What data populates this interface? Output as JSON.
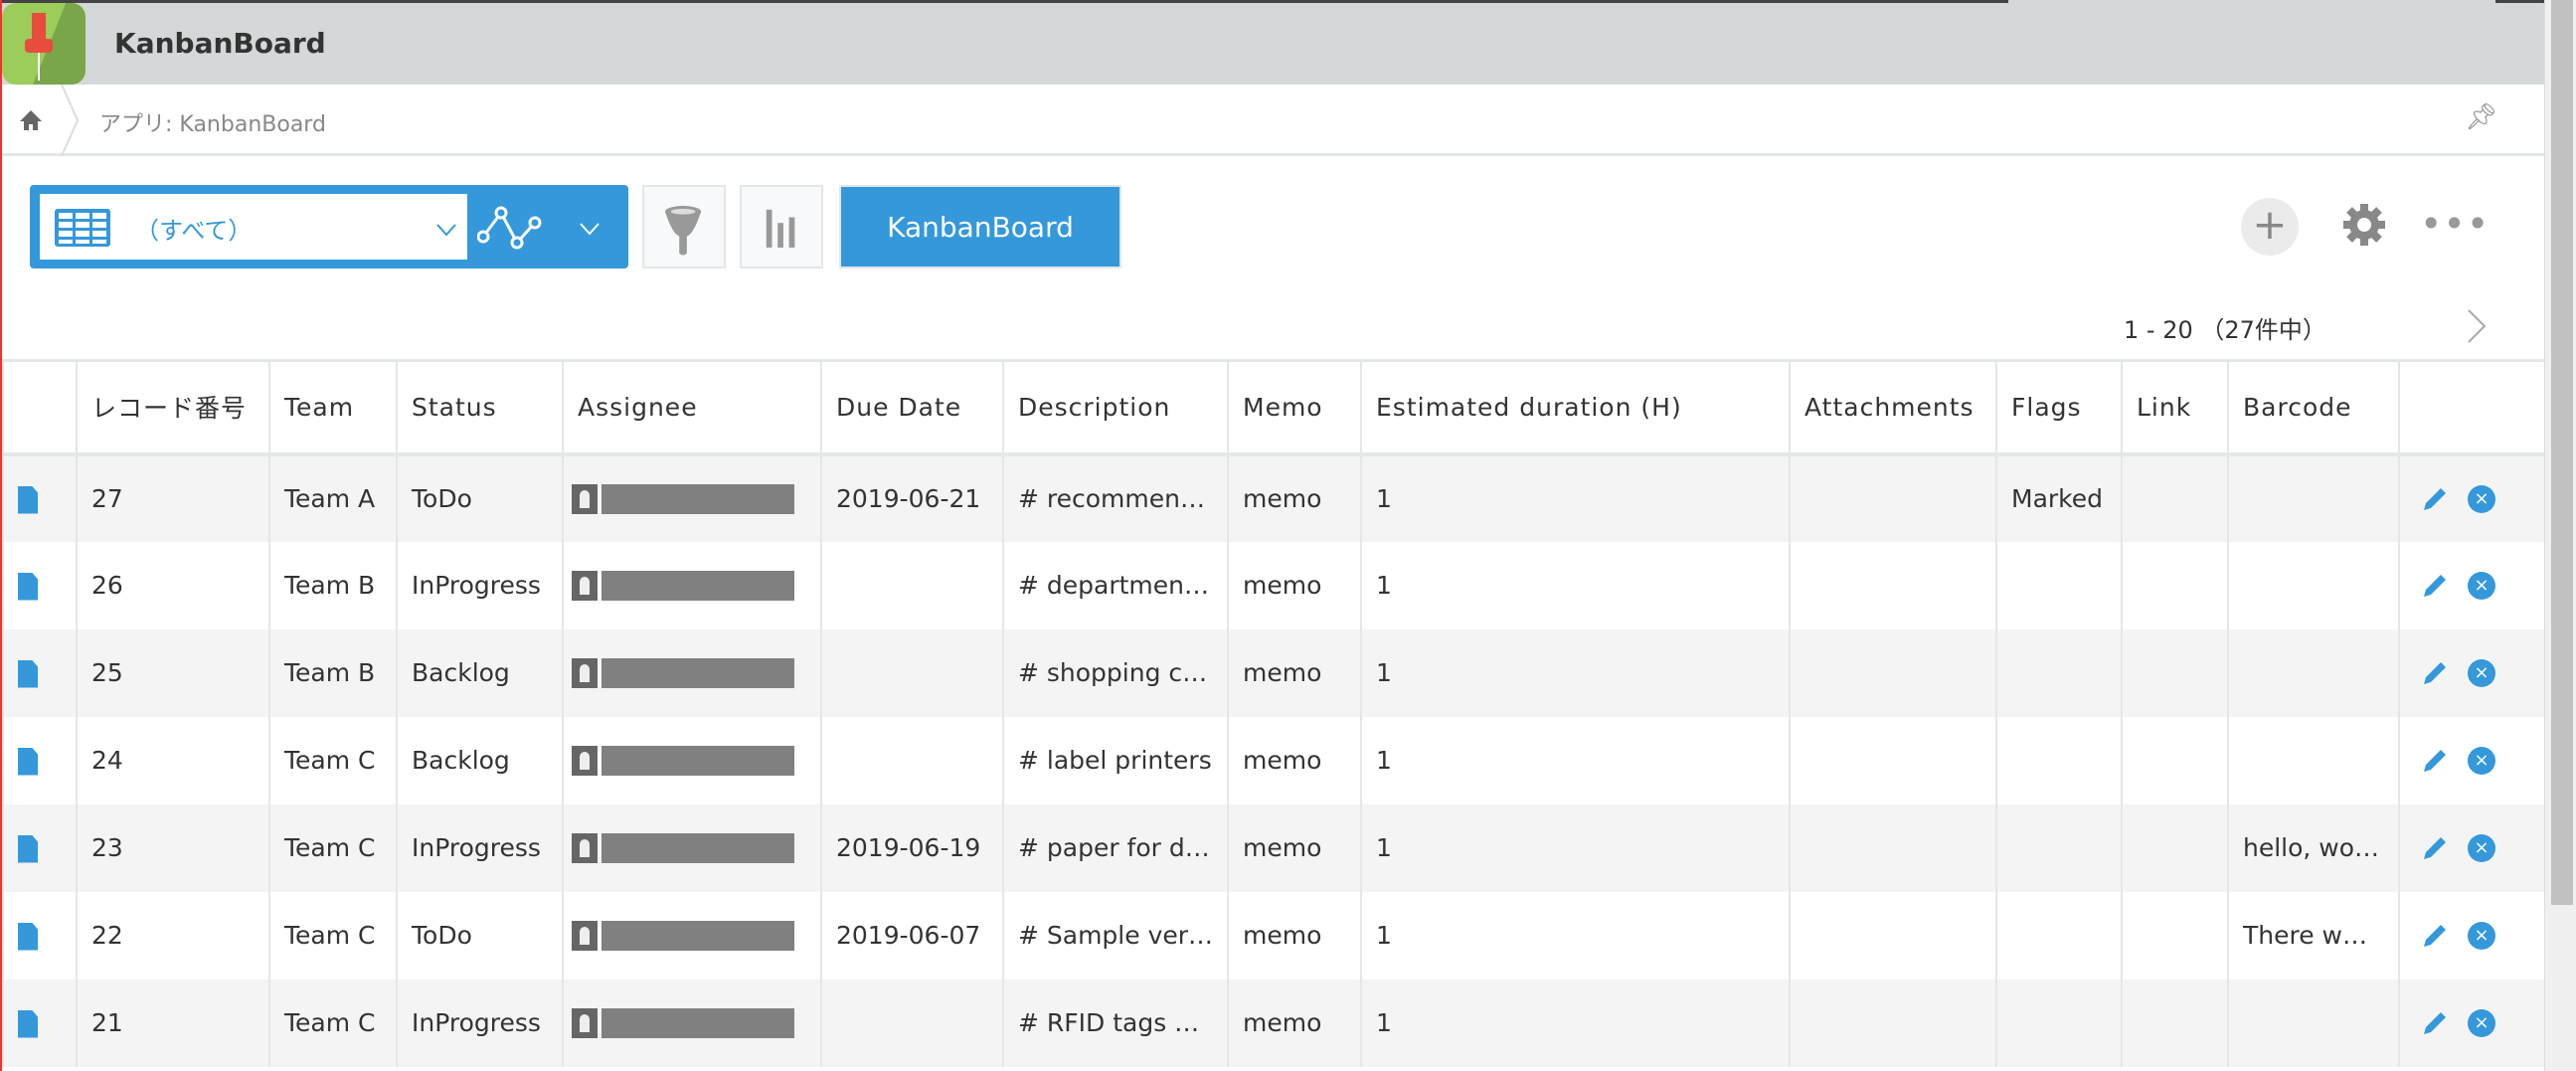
{
  "app": {
    "title": "KanbanBoard",
    "accent": "#3498db",
    "logo": "pushpin-logo"
  },
  "breadcrumb": {
    "home_icon": "home-icon",
    "text": "アプリ: KanbanBoard",
    "pin_icon": "pin-icon"
  },
  "toolbar": {
    "view_name": "（すべて）",
    "kanban_button": "KanbanBoard",
    "add_label": "+",
    "more_label": "•••"
  },
  "pager": {
    "text": "1 - 20 （27件中）"
  },
  "table": {
    "columns": [
      "",
      "レコード番号",
      "Team",
      "Status",
      "Assignee",
      "Due Date",
      "Description",
      "Memo",
      "Estimated duration (H)",
      "Attachments",
      "Flags",
      "Link",
      "Barcode",
      ""
    ],
    "rows": [
      {
        "id": "27",
        "team": "Team A",
        "status": "ToDo",
        "due": "2019-06-21",
        "desc": "# recommen…",
        "memo": "memo",
        "est": "1",
        "attach": "",
        "flags": "Marked",
        "link": "",
        "barcode": ""
      },
      {
        "id": "26",
        "team": "Team B",
        "status": "InProgress",
        "due": "",
        "desc": "# departmen…",
        "memo": "memo",
        "est": "1",
        "attach": "",
        "flags": "",
        "link": "",
        "barcode": ""
      },
      {
        "id": "25",
        "team": "Team B",
        "status": "Backlog",
        "due": "",
        "desc": "# shopping c…",
        "memo": "memo",
        "est": "1",
        "attach": "",
        "flags": "",
        "link": "",
        "barcode": ""
      },
      {
        "id": "24",
        "team": "Team C",
        "status": "Backlog",
        "due": "",
        "desc": "# label printers",
        "memo": "memo",
        "est": "1",
        "attach": "",
        "flags": "",
        "link": "",
        "barcode": ""
      },
      {
        "id": "23",
        "team": "Team C",
        "status": "InProgress",
        "due": "2019-06-19",
        "desc": "# paper for d…",
        "memo": "memo",
        "est": "1",
        "attach": "",
        "flags": "",
        "link": "",
        "barcode": "hello, wo…"
      },
      {
        "id": "22",
        "team": "Team C",
        "status": "ToDo",
        "due": "2019-06-07",
        "desc": "# Sample ver…",
        "memo": "memo",
        "est": "1",
        "attach": "",
        "flags": "",
        "link": "",
        "barcode": "There w…"
      },
      {
        "id": "21",
        "team": "Team C",
        "status": "InProgress",
        "due": "",
        "desc": "# RFID tags …",
        "memo": "memo",
        "est": "1",
        "attach": "",
        "flags": "",
        "link": "",
        "barcode": ""
      }
    ]
  }
}
